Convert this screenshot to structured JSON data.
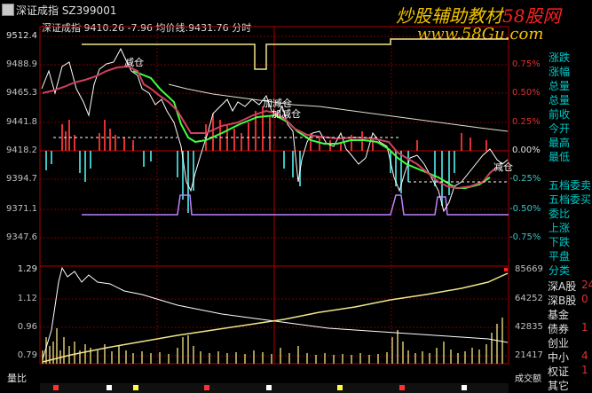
{
  "window": {
    "title": "深证成指  SZ399001"
  },
  "watermark": {
    "text_main": "炒股辅助教材",
    "text_brand": "58股网",
    "url": "www.58Gu.com"
  },
  "info": {
    "text": "深证成指 9410.26 -7.96 均价线:9431.76 分时"
  },
  "price_axis": {
    "labels": [
      "9512.4",
      "9488.9",
      "9465.3",
      "9441.8",
      "9418.2",
      "9394.7",
      "9371.1",
      "9347.6"
    ],
    "pct": [
      "0.75%",
      "0.50%",
      "0.25%",
      "0.00%",
      "-0.25%",
      "-0.50%",
      "-0.75%"
    ]
  },
  "volume_axis": {
    "left": [
      "1.29",
      "1.12",
      "0.96",
      "0.79"
    ],
    "right": [
      "85669",
      "64252",
      "42835",
      "21417"
    ],
    "bottom_left_label": "量比",
    "bottom_right_label": "成交额"
  },
  "annotations": [
    {
      "text": "减仓"
    },
    {
      "text": "加减仓"
    },
    {
      "text": "加减仓"
    },
    {
      "text": "减仓"
    }
  ],
  "right_panel": {
    "top_items": [
      "涨跌",
      "涨幅",
      "总量",
      "总量",
      "前收",
      "今开",
      "最高",
      "最低"
    ],
    "mid_items": [
      "五档委卖",
      "五档委买",
      "委比",
      "上涨",
      "下跌",
      "平盘"
    ],
    "section": "分类",
    "categories": [
      "深A股",
      "深B股",
      "基金",
      "债券",
      "创业",
      "中小",
      "权证",
      "其它"
    ],
    "side_digits": [
      "24",
      "0",
      "1",
      "4",
      "1"
    ]
  },
  "colors": {
    "price_line": "#ffffff",
    "avg_line": "#f0e68c",
    "green_line": "#40ff40",
    "purple_line": "#c080ff",
    "up_bar": "#e03030",
    "down_bar": "#40c0c0",
    "grid_red": "#b00000"
  }
}
